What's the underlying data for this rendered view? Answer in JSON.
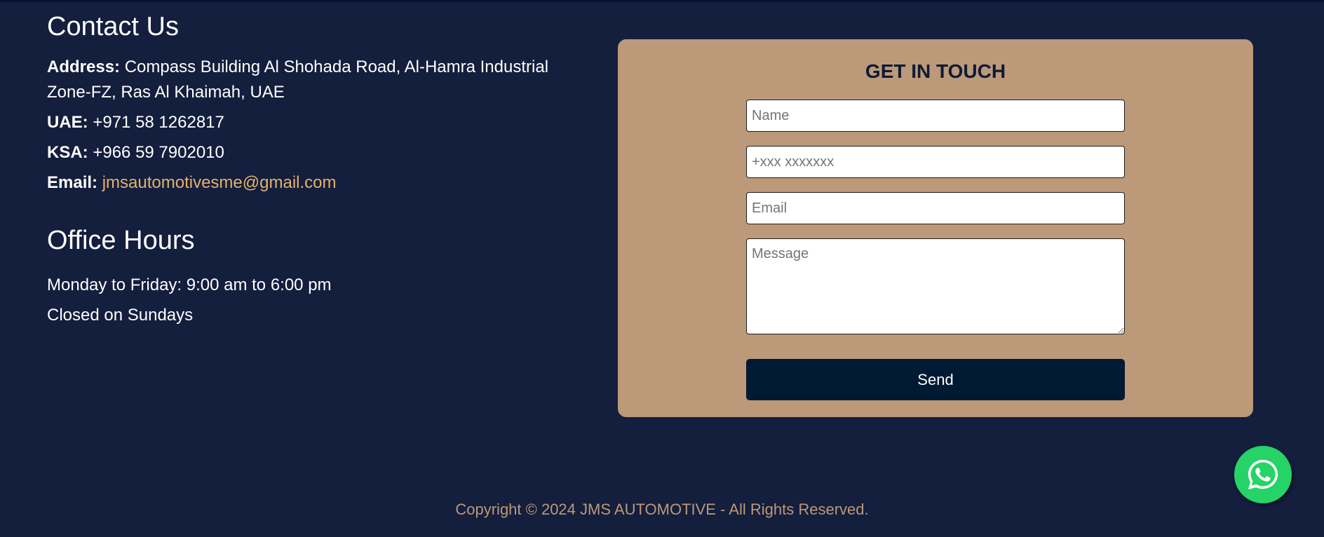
{
  "contact": {
    "title": "Contact Us",
    "address_label": "Address:",
    "address_value": " Compass Building Al Shohada Road, Al-Hamra Industrial Zone-FZ, Ras Al Khaimah, UAE",
    "uae_label": "UAE:",
    "uae_value": " +971 58 1262817",
    "ksa_label": "KSA:",
    "ksa_value": " +966 59 7902010",
    "email_label": "Email:",
    "email_value": "jmsautomotivesme@gmail.com"
  },
  "hours": {
    "title": "Office Hours",
    "weekdays": "Monday to Friday: 9:00 am to 6:00 pm",
    "closed": "Closed on Sundays"
  },
  "form": {
    "title": "GET IN TOUCH",
    "name_placeholder": "Name",
    "phone_placeholder": "+xxx xxxxxxx",
    "email_placeholder": "Email",
    "message_placeholder": "Message",
    "send_label": "Send"
  },
  "footer": {
    "copyright": "Copyright © 2024 JMS AUTOMOTIVE - All Rights Reserved."
  },
  "whatsapp": {
    "icon": "whatsapp-icon"
  },
  "colors": {
    "background": "#141e3d",
    "accent": "#bb9979",
    "link": "#e2b26d",
    "button": "#001a33",
    "whatsapp": "#25d366"
  }
}
